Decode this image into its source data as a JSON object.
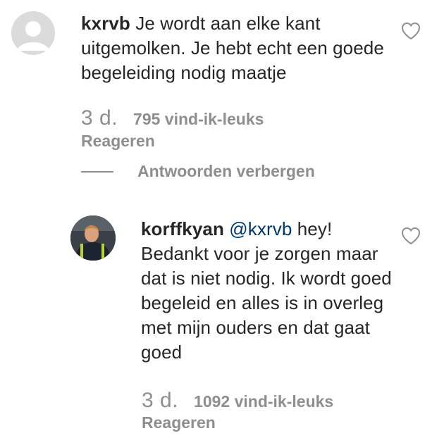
{
  "comments": [
    {
      "username": "kxrvb",
      "mention": "",
      "text": "Je wordt aan elke kant uitgemolken. Je hebt echt een goede begeleiding nodig maatje",
      "time": "3 d.",
      "likes": "795 vind-ik-leuks",
      "reply_label": "Reageren",
      "avatar_icon": "default-avatar-icon",
      "like_icon": "heart-outline-icon"
    },
    {
      "username": "korffkyan",
      "mention": "@kxrvb",
      "text": "hey! Bedankt voor je zorgen maar dat is niet nodig. Ik wordt goed begeleid en alles is in overleg met mijn ouders en dat gaat goed",
      "time": "3 d.",
      "likes": "1092 vind-ik-leuks",
      "reply_label": "Reageren",
      "avatar_icon": "profile-photo",
      "like_icon": "heart-outline-icon"
    }
  ],
  "thread": {
    "hide_replies_label": "Antwoorden verbergen"
  },
  "colors": {
    "text": "#262626",
    "secondary": "#8e8e8e",
    "mention": "#00376b"
  }
}
